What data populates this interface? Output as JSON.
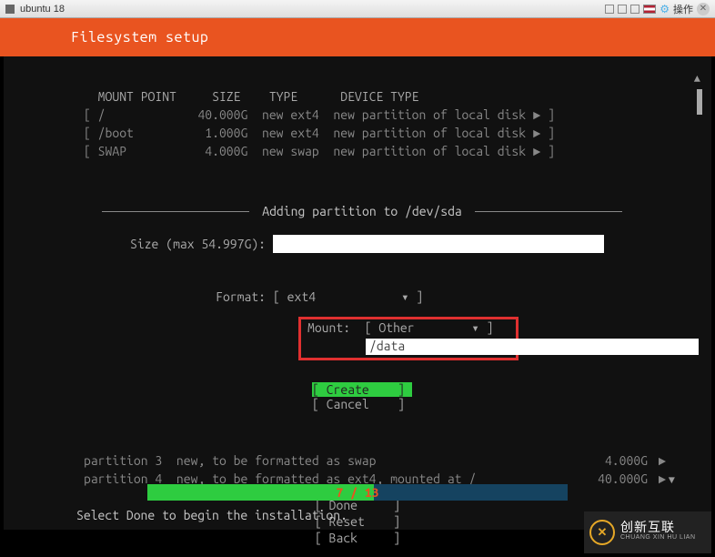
{
  "vm": {
    "title": "ubuntu 18",
    "action_label": "操作"
  },
  "header": {
    "title": "Filesystem setup"
  },
  "table": {
    "headers": "  MOUNT POINT     SIZE    TYPE      DEVICE TYPE",
    "rows": [
      "[ /             40.000G  new ext4  new partition of local disk ► ]",
      "[ /boot          1.000G  new ext4  new partition of local disk ► ]",
      "[ SWAP           4.000G  new swap  new partition of local disk ► ]"
    ]
  },
  "dialog": {
    "title": " Adding partition to /dev/sda ",
    "size_label": "Size (max 54.997G):",
    "size_value": "",
    "format_label": "Format:",
    "format_value": "[ ext4            ▾ ]",
    "mount_label": "Mount:",
    "mount_value_sel": "[ Other        ▾ ]",
    "mount_path": "/data",
    "create": "[ Create    ]",
    "cancel": "[ Cancel    ]"
  },
  "lower": {
    "rows": [
      {
        "text": "partition 3  new, to be formatted as swap",
        "size": "4.000G",
        "arrow": "►"
      },
      {
        "text": "partition 4  new, to be formatted as ext4, mounted at /",
        "size": "40.000G",
        "arrow": "►"
      }
    ]
  },
  "bottom_buttons": {
    "done": "[ Done     ]",
    "reset": "[ Reset    ]",
    "back": "[ Back     ]"
  },
  "progress": {
    "label": "7 / 13"
  },
  "footer": "Select Done to begin the installation.",
  "watermark": {
    "big": "创新互联",
    "small": "CHUANG XIN HU LIAN"
  }
}
